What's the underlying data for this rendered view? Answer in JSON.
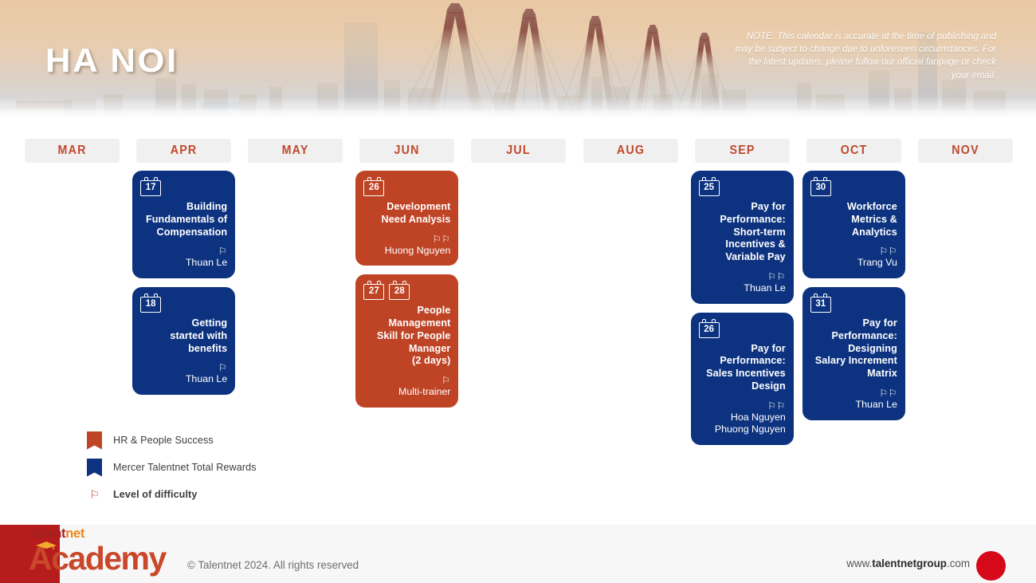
{
  "header": {
    "city_title": "HA NOI",
    "note": "NOTE: This calendar is accurate at the time of publishing and may be subject to change due to unforeseen circumstances. For the latest updates, please follow our official fanpage or check your email."
  },
  "months": [
    "MAR",
    "APR",
    "MAY",
    "JUN",
    "JUL",
    "AUG",
    "SEP",
    "OCT",
    "NOV"
  ],
  "colors": {
    "hr_people_success": "#bf4426",
    "mercer_total_rewards": "#0d3380",
    "month_label": "#c04a2e",
    "month_pill_bg": "#f0f0f0",
    "difficulty_flag": "#c04a2e",
    "footer_bar": "#b71c1c",
    "footer_dot": "#d5091a"
  },
  "courses": [
    {
      "month": "APR",
      "column": 1,
      "category": "blue",
      "dates": [
        "17"
      ],
      "title": "Building\nFundamentals of\nCompensation",
      "difficulty": 1,
      "trainer": "Thuan Le"
    },
    {
      "month": "APR",
      "column": 1,
      "category": "blue",
      "dates": [
        "18"
      ],
      "title": "Getting\nstarted with\nbenefits",
      "difficulty": 1,
      "trainer": "Thuan Le"
    },
    {
      "month": "JUN",
      "column": 3,
      "category": "orange",
      "dates": [
        "26"
      ],
      "title": "Development\nNeed Analysis",
      "difficulty": 2,
      "trainer": "Huong Nguyen"
    },
    {
      "month": "JUN",
      "column": 3,
      "category": "orange",
      "dates": [
        "27",
        "28"
      ],
      "title": "People\nManagement\nSkill for People\nManager\n(2 days)",
      "difficulty": 1,
      "trainer": "Multi-trainer"
    },
    {
      "month": "SEP",
      "column": 6,
      "category": "blue",
      "dates": [
        "25"
      ],
      "title": "Pay for\nPerformance:\nShort-term\nIncentives &\nVariable Pay",
      "difficulty": 2,
      "trainer": "Thuan Le"
    },
    {
      "month": "SEP",
      "column": 6,
      "category": "blue",
      "dates": [
        "26"
      ],
      "title": "Pay for\nPerformance:\nSales Incentives\nDesign",
      "difficulty": 2,
      "trainer": "Hoa Nguyen\nPhuong Nguyen"
    },
    {
      "month": "OCT",
      "column": 7,
      "category": "blue",
      "dates": [
        "30"
      ],
      "title": "Workforce\nMetrics &\nAnalytics",
      "difficulty": 2,
      "trainer": "Trang Vu"
    },
    {
      "month": "OCT",
      "column": 7,
      "category": "blue",
      "dates": [
        "31"
      ],
      "title": "Pay for\nPerformance:\nDesigning\nSalary Increment\nMatrix",
      "difficulty": 2,
      "trainer": "Thuan Le"
    }
  ],
  "legend": {
    "items": [
      {
        "label": "HR & People Success",
        "swatch": "orange"
      },
      {
        "label": "Mercer Talentnet Total Rewards",
        "swatch": "blue"
      }
    ],
    "difficulty_label": "Level of difficulty"
  },
  "footer": {
    "logo_talent": "talent",
    "logo_net": "net",
    "logo_academy": "Academy",
    "copyright": "© Talentnet 2024. All rights reserved",
    "url_prefix": "www.",
    "url_brand": "talentnetgroup",
    "url_suffix": ".com"
  }
}
